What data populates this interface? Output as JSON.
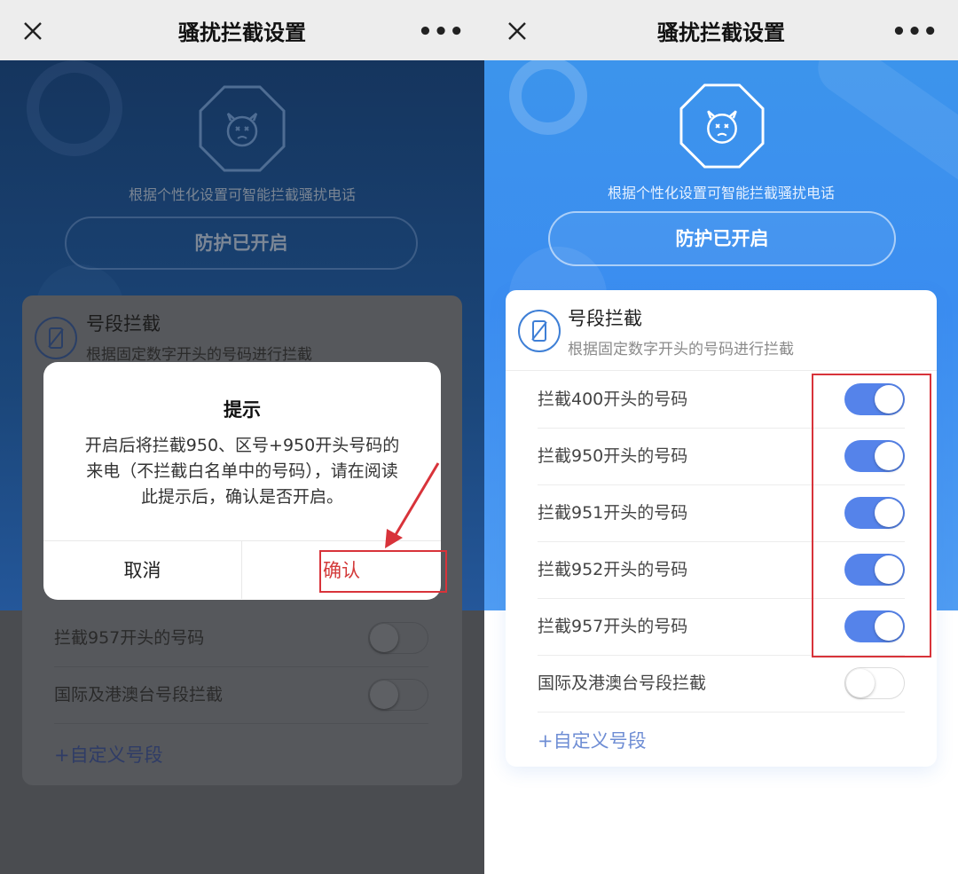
{
  "header": {
    "title": "骚扰拦截设置"
  },
  "hero": {
    "description": "根据个性化设置可智能拦截骚扰电话",
    "protect_button": "防护已开启"
  },
  "card": {
    "title": "号段拦截",
    "subtitle": "根据固定数字开头的号码进行拦截"
  },
  "right_panel": {
    "rows": [
      {
        "label": "拦截400开头的号码",
        "enabled": true
      },
      {
        "label": "拦截950开头的号码",
        "enabled": true
      },
      {
        "label": "拦截951开头的号码",
        "enabled": true
      },
      {
        "label": "拦截952开头的号码",
        "enabled": true
      },
      {
        "label": "拦截957开头的号码",
        "enabled": true
      },
      {
        "label": "国际及港澳台号段拦截",
        "enabled": false
      }
    ],
    "custom_link": "+自定义号段"
  },
  "left_panel": {
    "rows": [
      {
        "label": "拦截957开头的号码",
        "enabled": false
      },
      {
        "label": "国际及港澳台号段拦截",
        "enabled": false
      }
    ],
    "custom_link": "+自定义号段"
  },
  "dialog": {
    "title": "提示",
    "body_lines": [
      "开启后将拦截950、区号+950开头号码的",
      "来电（不拦截白名单中的号码），请在阅读",
      "此提示后，确认是否开启。"
    ],
    "cancel_label": "取消",
    "confirm_label": "确认"
  },
  "colors": {
    "accent_blue": "#3b8df0",
    "toggle_on": "#5583ea",
    "annotation_red": "#d8333a"
  },
  "icons": {
    "close": "close-icon",
    "more": "more-icon",
    "hero": "octagon-face-icon",
    "card": "phone-slash-icon"
  }
}
